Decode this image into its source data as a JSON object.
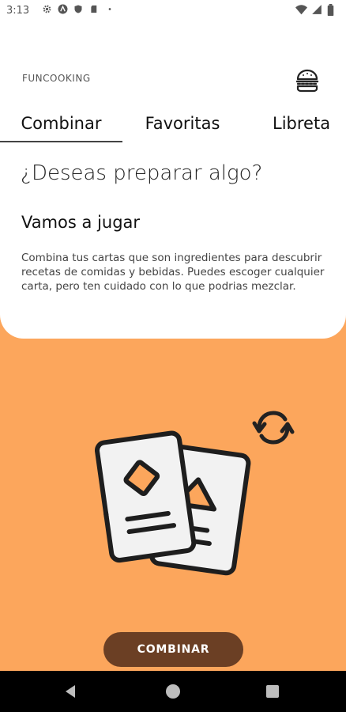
{
  "status_bar": {
    "time": "3:13",
    "left_icons": [
      "settings-icon",
      "vpn-icon",
      "shield-icon",
      "sd-card-icon",
      "dot-icon"
    ],
    "right_icons": [
      "wifi-icon",
      "signal-icon",
      "battery-icon"
    ]
  },
  "header": {
    "brand": "FUNCOOKING",
    "menu_icon": "burger-icon"
  },
  "tabs": [
    {
      "label": "Combinar",
      "active": true
    },
    {
      "label": "Favoritas",
      "active": false
    },
    {
      "label": "Libreta",
      "active": false
    }
  ],
  "intro": {
    "question": "¿Deseas preparar algo?",
    "subtitle": "Vamos a jugar",
    "description": "Combina tus cartas que son ingredientes para descubrir recetas de comidas y bebidas. Puedes escoger cualquier carta, pero ten cuidado con lo que podrias mezclar."
  },
  "illustration": {
    "cards_icon": "cards-icon",
    "refresh_icon": "refresh-icon"
  },
  "actions": {
    "combine_label": "COMBINAR"
  },
  "nav": {
    "back_icon": "back-icon",
    "home_icon": "home-icon",
    "recents_icon": "recents-icon"
  },
  "colors": {
    "background": "#FCA65C",
    "panel": "#FFFFFF",
    "button": "#6B3F24",
    "nav_bar": "#000000"
  }
}
